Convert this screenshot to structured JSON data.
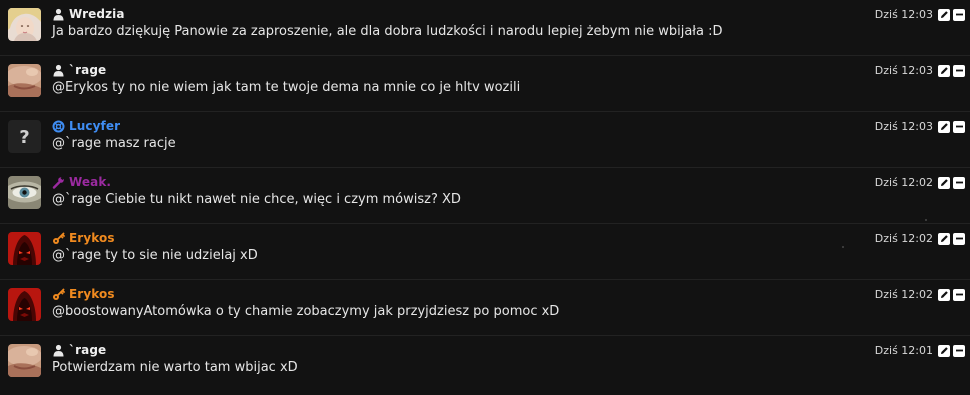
{
  "messages": [
    {
      "author": "Wredzia",
      "name_color": "#f0f0f0",
      "role_icon": "user-icon",
      "avatar": "photo-girl-avatar",
      "text": "Ja bardzo dziękuję Panowie za zaproszenie, ale dla dobra ludzkości i narodu lepiej żebym nie wbijała :D",
      "time": "Dziś 12:03"
    },
    {
      "author": "`rage",
      "name_color": "#f0f0f0",
      "role_icon": "user-icon",
      "avatar": "photo-face-avatar",
      "text": "@Erykos ty no nie wiem jak tam te twoje dema na mnie co je hltv wozili",
      "time": "Dziś 12:03"
    },
    {
      "author": "Lucyfer",
      "name_color": "#3f8df3",
      "role_icon": "lifebuoy-icon",
      "avatar": "question-mark-avatar",
      "text": "@`rage masz racje",
      "time": "Dziś 12:03"
    },
    {
      "author": "Weak.",
      "name_color": "#9b2aa0",
      "role_icon": "wrench-icon",
      "avatar": "eye-avatar",
      "text": "@`rage Ciebie tu nikt nawet nie chce, więc i czym mówisz? XD",
      "time": "Dziś 12:02"
    },
    {
      "author": "Erykos",
      "name_color": "#f08a1f",
      "role_icon": "key-icon",
      "avatar": "red-hood-avatar",
      "text": "@`rage ty to sie nie udzielaj xD",
      "time": "Dziś 12:02"
    },
    {
      "author": "Erykos",
      "name_color": "#f08a1f",
      "role_icon": "key-icon",
      "avatar": "red-hood-avatar",
      "text": "@boostowanyAtomówka o ty chamie zobaczymy jak przyjdziesz po pomoc xD",
      "time": "Dziś 12:02"
    },
    {
      "author": "`rage",
      "name_color": "#f0f0f0",
      "role_icon": "user-icon",
      "avatar": "photo-face-avatar",
      "text": "Potwierdzam nie warto tam wbijac xD",
      "time": "Dziś 12:01"
    }
  ],
  "actions": {
    "edit_icon": "pencil-icon",
    "delete_icon": "minus-icon"
  }
}
